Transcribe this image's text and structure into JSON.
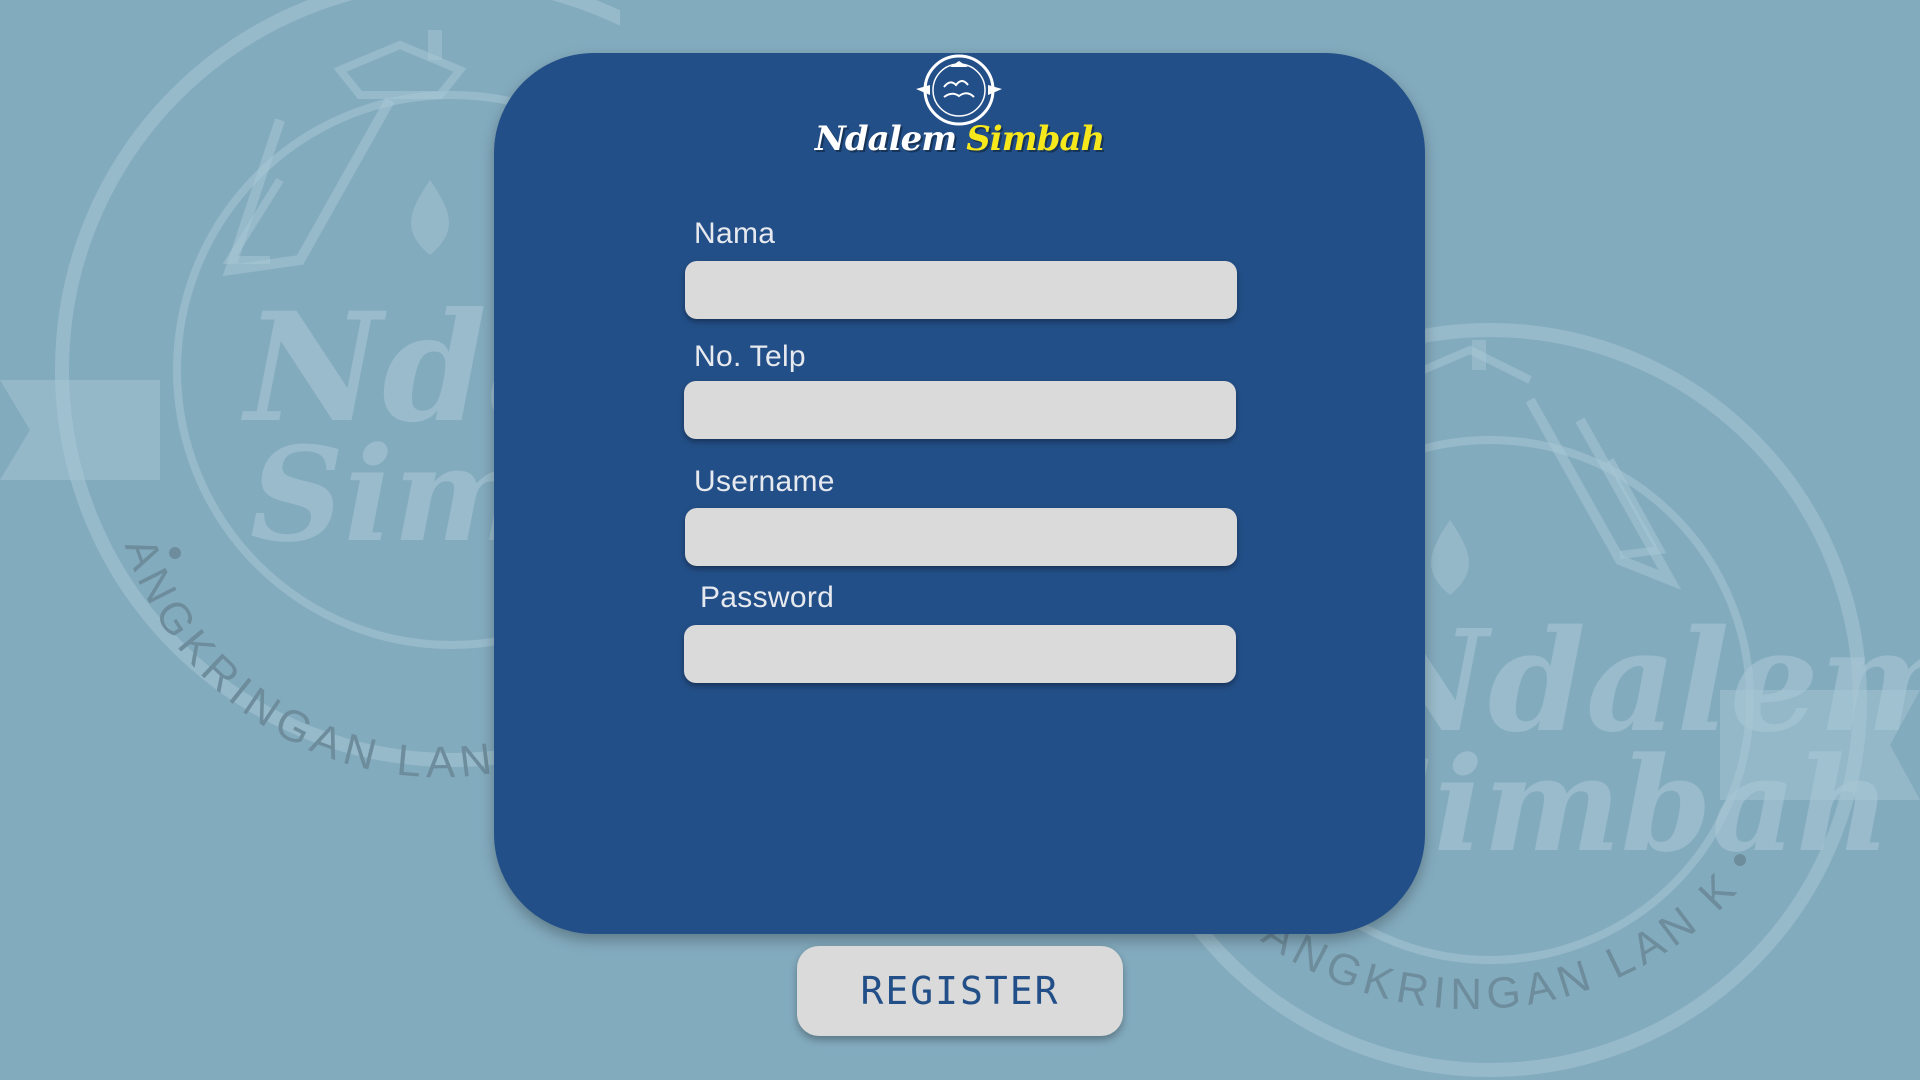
{
  "brand": {
    "name_part1": "Ndalem",
    "name_part2": "Simbah",
    "emblem_icon": "ndalem-simbah-logo",
    "primary_color": "#234f88",
    "accent_color": "#f7e81c"
  },
  "watermark": {
    "left_text_line1": "Ndalem",
    "left_text_line2": "Simbah",
    "left_ring_text": "ANGKRINGAN LAN KOPIAN",
    "right_text_line1": "Ndalem",
    "right_text_line2": "Simbah",
    "right_ring_text": "ANGKRINGAN LAN KOPIAN"
  },
  "form": {
    "fields": [
      {
        "label": "Nama",
        "value": ""
      },
      {
        "label": "No. Telp",
        "value": ""
      },
      {
        "label": "Username",
        "value": ""
      },
      {
        "label": "Password",
        "value": ""
      }
    ],
    "register_label": "REGISTER"
  },
  "colors": {
    "background": "#83abbe",
    "input_background": "#dadada",
    "label_color": "#e6e9ee"
  }
}
